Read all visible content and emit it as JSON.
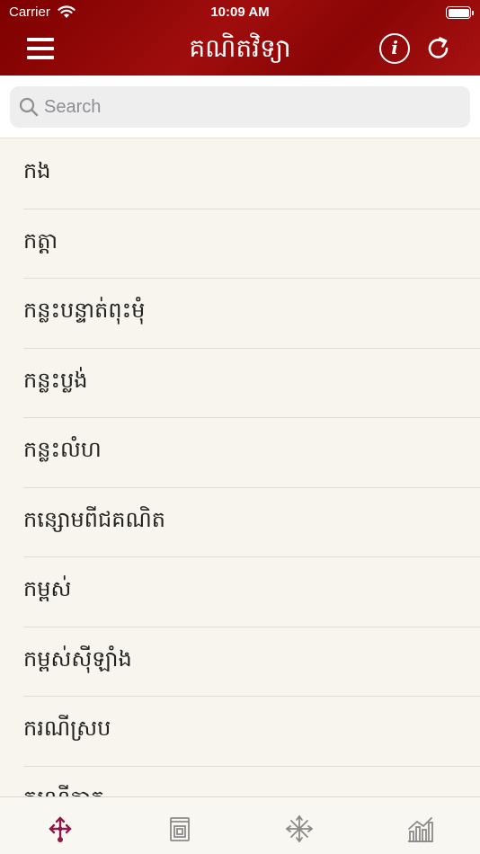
{
  "status_bar": {
    "carrier": "Carrier",
    "time": "10:09 AM"
  },
  "nav": {
    "title": "គណិតវិទ្យា",
    "info_label": "i"
  },
  "search": {
    "placeholder": "Search"
  },
  "terms": [
    "កង",
    "កត្តា",
    "កន្លះបន្ទាត់ពុះមុំ",
    "កន្លះប្លង់",
    "កន្លះលំហ",
    "កន្សោមពីជគណិត",
    "កម្ពស់",
    "កម្ពស់ស៊ីឡាំង",
    "ករណីស្រប",
    "ករណីភាគ"
  ],
  "colors": {
    "header": "#9a0a0a",
    "tab_active": "#8b1a4a",
    "tab_inactive": "#8a8a8a"
  },
  "tabs": [
    {
      "icon": "network-icon",
      "active": true
    },
    {
      "icon": "book-icon",
      "active": false
    },
    {
      "icon": "compass-icon",
      "active": false
    },
    {
      "icon": "chart-icon",
      "active": false
    }
  ]
}
